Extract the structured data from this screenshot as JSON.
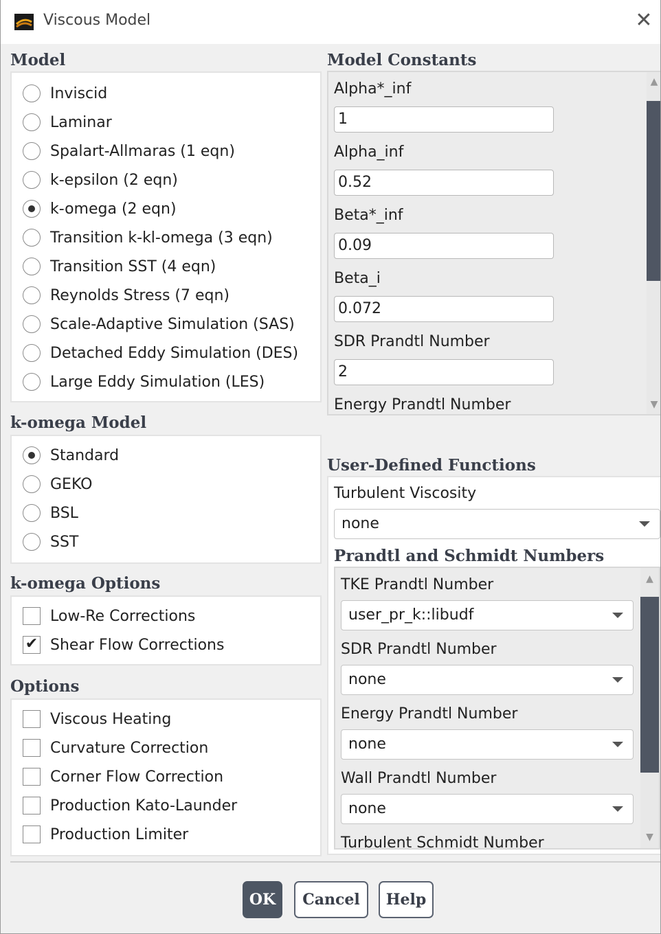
{
  "window": {
    "title": "Viscous Model"
  },
  "model": {
    "title": "Model",
    "options": [
      {
        "label": "Inviscid",
        "selected": false
      },
      {
        "label": "Laminar",
        "selected": false
      },
      {
        "label": "Spalart-Allmaras (1 eqn)",
        "selected": false
      },
      {
        "label": "k-epsilon (2 eqn)",
        "selected": false
      },
      {
        "label": "k-omega (2 eqn)",
        "selected": true
      },
      {
        "label": "Transition k-kl-omega (3 eqn)",
        "selected": false
      },
      {
        "label": "Transition SST (4 eqn)",
        "selected": false
      },
      {
        "label": "Reynolds Stress (7 eqn)",
        "selected": false
      },
      {
        "label": "Scale-Adaptive Simulation (SAS)",
        "selected": false
      },
      {
        "label": "Detached Eddy Simulation (DES)",
        "selected": false
      },
      {
        "label": "Large Eddy Simulation (LES)",
        "selected": false
      }
    ]
  },
  "komega_model": {
    "title": "k-omega Model",
    "options": [
      {
        "label": "Standard",
        "selected": true
      },
      {
        "label": "GEKO",
        "selected": false
      },
      {
        "label": "BSL",
        "selected": false
      },
      {
        "label": "SST",
        "selected": false
      }
    ]
  },
  "komega_options": {
    "title": "k-omega Options",
    "items": [
      {
        "label": "Low-Re Corrections",
        "checked": false
      },
      {
        "label": "Shear Flow Corrections",
        "checked": true
      }
    ]
  },
  "options": {
    "title": "Options",
    "items": [
      {
        "label": "Viscous Heating",
        "checked": false
      },
      {
        "label": "Curvature Correction",
        "checked": false
      },
      {
        "label": "Corner Flow Correction",
        "checked": false
      },
      {
        "label": "Production Kato-Launder",
        "checked": false
      },
      {
        "label": "Production Limiter",
        "checked": false
      }
    ]
  },
  "model_constants": {
    "title": "Model Constants",
    "items": [
      {
        "label": "Alpha*_inf",
        "value": "1"
      },
      {
        "label": "Alpha_inf",
        "value": "0.52"
      },
      {
        "label": "Beta*_inf",
        "value": "0.09"
      },
      {
        "label": "Beta_i",
        "value": "0.072"
      },
      {
        "label": "SDR Prandtl Number",
        "value": "2"
      },
      {
        "label": "Energy Prandtl Number",
        "value": ""
      }
    ]
  },
  "udf": {
    "title": "User-Defined Functions",
    "turbulent_viscosity_label": "Turbulent Viscosity",
    "turbulent_viscosity_value": "none",
    "prandtl_title": "Prandtl and Schmidt Numbers",
    "prandtl_items": [
      {
        "label": "TKE Prandtl Number",
        "value": "user_pr_k::libudf"
      },
      {
        "label": "SDR Prandtl Number",
        "value": "none"
      },
      {
        "label": "Energy Prandtl Number",
        "value": "none"
      },
      {
        "label": "Wall Prandtl Number",
        "value": "none"
      },
      {
        "label": "Turbulent Schmidt Number",
        "value": ""
      }
    ]
  },
  "buttons": {
    "ok": "OK",
    "cancel": "Cancel",
    "help": "Help"
  },
  "colors": {
    "accent": "#4d5663",
    "panel": "#ececec",
    "title_text": "#3a3f4a"
  }
}
